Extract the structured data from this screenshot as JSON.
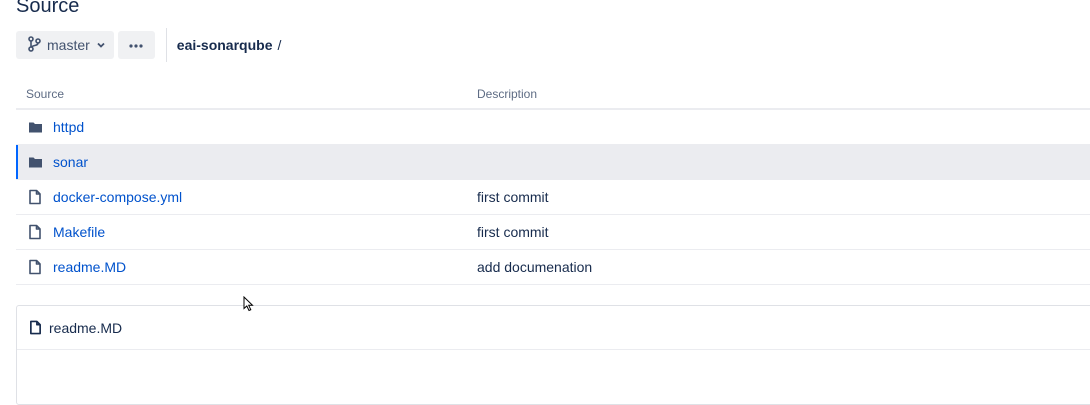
{
  "page": {
    "title": "Source"
  },
  "toolbar": {
    "branch_label": "master",
    "branch_icon": "git-branch-icon",
    "more_icon": "more-horizontal-icon"
  },
  "breadcrumb": {
    "repo": "eai-sonarqube",
    "separator": "/"
  },
  "table": {
    "columns": [
      "Source",
      "Description"
    ],
    "rows": [
      {
        "type": "folder",
        "name": "httpd",
        "description": ""
      },
      {
        "type": "folder",
        "name": "sonar",
        "description": "",
        "selected": true
      },
      {
        "type": "file",
        "name": "docker-compose.yml",
        "description": "first commit"
      },
      {
        "type": "file",
        "name": "Makefile",
        "description": "first commit"
      },
      {
        "type": "file",
        "name": "readme.MD",
        "description": "add documenation"
      }
    ]
  },
  "readme": {
    "title": "readme.MD"
  },
  "colors": {
    "link": "#0052cc",
    "text": "#172b4d",
    "selected_row": "#ebecf0",
    "selected_accent": "#0065ff",
    "button_bg": "#f0f1f3"
  }
}
